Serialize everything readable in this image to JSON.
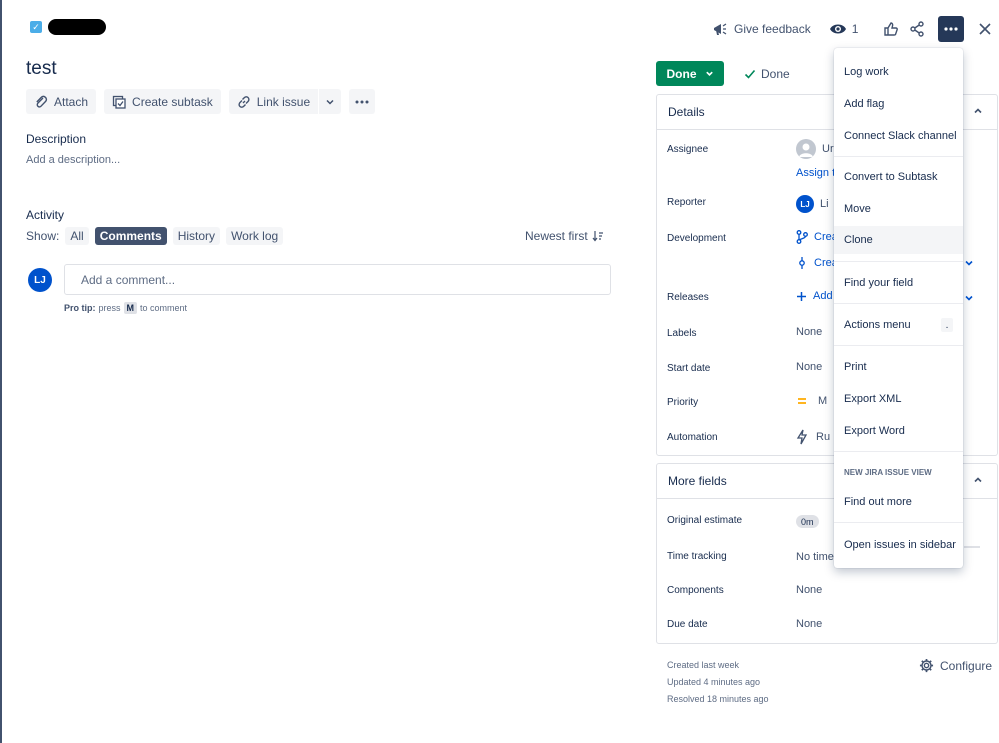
{
  "header": {
    "feedback_label": "Give feedback",
    "watch_count": "1"
  },
  "issue": {
    "title": "test",
    "toolbar": {
      "attach": "Attach",
      "create_subtask": "Create subtask",
      "link_issue": "Link issue"
    },
    "description_label": "Description",
    "description_placeholder": "Add a description..."
  },
  "activity": {
    "label": "Activity",
    "show_label": "Show:",
    "filters": [
      "All",
      "Comments",
      "History",
      "Work log"
    ],
    "active_filter": "Comments",
    "sort_label": "Newest first",
    "comment_placeholder": "Add a comment...",
    "user_initials": "LJ",
    "pro_tip_prefix": "Pro tip:",
    "pro_tip_press": "press",
    "pro_tip_key": "M",
    "pro_tip_suffix": "to comment"
  },
  "status": {
    "button_label": "Done",
    "resolution": "Done"
  },
  "details": {
    "title": "Details",
    "assignee_label": "Assignee",
    "assignee_value": "Ur",
    "assign_link": "Assign t",
    "reporter_label": "Reporter",
    "reporter_initials": "LJ",
    "reporter_value": "Li",
    "development_label": "Development",
    "dev_item_1": "Crea",
    "dev_item_2": "Crea",
    "releases_label": "Releases",
    "releases_value": "Add",
    "labels_label": "Labels",
    "labels_value": "None",
    "start_date_label": "Start date",
    "start_date_value": "None",
    "priority_label": "Priority",
    "priority_value": "M",
    "automation_label": "Automation",
    "automation_value": "Ru"
  },
  "more_fields": {
    "title": "More fields",
    "original_estimate_label": "Original estimate",
    "original_estimate_value": "0m",
    "time_tracking_label": "Time tracking",
    "time_tracking_value": "No time",
    "components_label": "Components",
    "components_value": "None",
    "due_date_label": "Due date",
    "due_date_value": "None"
  },
  "meta": {
    "created": "Created last week",
    "updated": "Updated 4 minutes ago",
    "resolved": "Resolved 18 minutes ago",
    "configure": "Configure"
  },
  "menu": {
    "log_work": "Log work",
    "add_flag": "Add flag",
    "connect_slack": "Connect Slack channel",
    "convert_subtask": "Convert to Subtask",
    "move": "Move",
    "clone": "Clone",
    "find_field": "Find your field",
    "actions_menu": "Actions menu",
    "actions_shortcut": ".",
    "print": "Print",
    "export_xml": "Export XML",
    "export_word": "Export Word",
    "heading_new_view": "NEW JIRA ISSUE VIEW",
    "find_out_more": "Find out more",
    "open_sidebar": "Open issues in sidebar"
  },
  "colors": {
    "status_green": "#00875a",
    "link_blue": "#0052cc",
    "header_dark": "#253858"
  }
}
